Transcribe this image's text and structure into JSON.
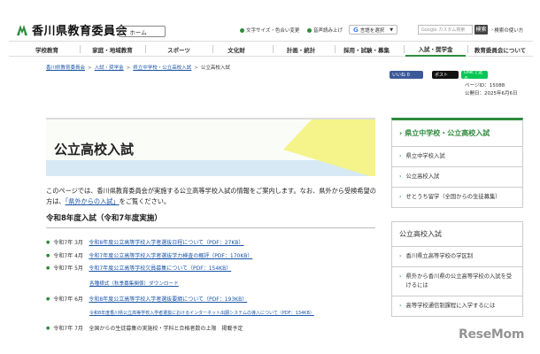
{
  "header": {
    "site_title": "香川県教育委員会",
    "home_label": "ホーム",
    "font_size_label": "文字サイズ・色合い変更",
    "read_aloud_label": "音声読み上げ",
    "language_label": "言語を選択",
    "search_placeholder": "Google カスタム検索",
    "search_button_label": "検索",
    "search_method_label": "検索の使い方"
  },
  "nav": {
    "items": [
      "学校教育",
      "家庭・地域教育",
      "スポーツ",
      "文化財",
      "計画・統計",
      "採用・試験・募集",
      "入試・奨学金",
      "教育委員会について"
    ]
  },
  "breadcrumb": [
    "香川県教育委員会",
    "入試・奨学金",
    "県立中学校・公立高校入試",
    "公立高校入試"
  ],
  "share": {
    "facebook": "いいね 0",
    "x": "ポスト",
    "line": "LINEで送る"
  },
  "page_info": {
    "page_id": "ページID：15088",
    "published": "公開日：2025年6月6日"
  },
  "main": {
    "title": "公立高校入試",
    "intro_text": "このページでは、香川県教育委員会が実施する公立高等学校入試の情報をご案内します。なお、県外から受検希望の方は、",
    "intro_link": "「県外からの入試」",
    "intro_end": "をご覧ください。",
    "section_heading": "令和8年度入試（令和7年度実施）",
    "entries": [
      {
        "date": "令和7年 3月",
        "link": "令和8年度公立高等学校入学者選抜日程について（PDF：27KB）",
        "text": ""
      },
      {
        "date": "令和7年 4月",
        "link": "令和7年度公立高等学校入学者選抜学力検査の概評（PDF：170KB）",
        "text": ""
      },
      {
        "date": "令和7年 5月",
        "link": "令和7年度公立高等学校欠員募集について（PDF：154KB）",
        "text": ""
      },
      {
        "date": "令和7年 6月",
        "link": "令和8年度公立高等学校入学者選抜要綱について（PDF：193KB）",
        "text": ""
      },
      {
        "date": "令和7年 7月",
        "link": "",
        "text": "全国からの生徒募集の実施校・学科と合格者数の上限　掲載予定"
      }
    ],
    "subentries": [
      "各種様式（秋季募集関係）ダウンロード",
      "令和8年度香川県公立高等学校入学者選抜におけるインターネット出願システムの導入について（PDF：134KB）"
    ]
  },
  "sidebar": {
    "heading": "県立中学校・公立高校入試",
    "items": [
      "県立中学校入試",
      "公立高校入試",
      "せとうち留学（全国からの生徒募集）"
    ],
    "heading2": "公立高校入試",
    "items2": [
      "香川県立高等学校の学区制",
      "県外から香川県の公立高等学校の入試を受けるには",
      "高等学校通信制課程に入学するには"
    ]
  },
  "watermark": "ReseMom",
  "colors": {
    "brand_green": "#2e8b3d",
    "link_blue": "#1a55a8",
    "banner_yellow": "#f4f48a",
    "banner_blue": "#d7e9f5"
  }
}
